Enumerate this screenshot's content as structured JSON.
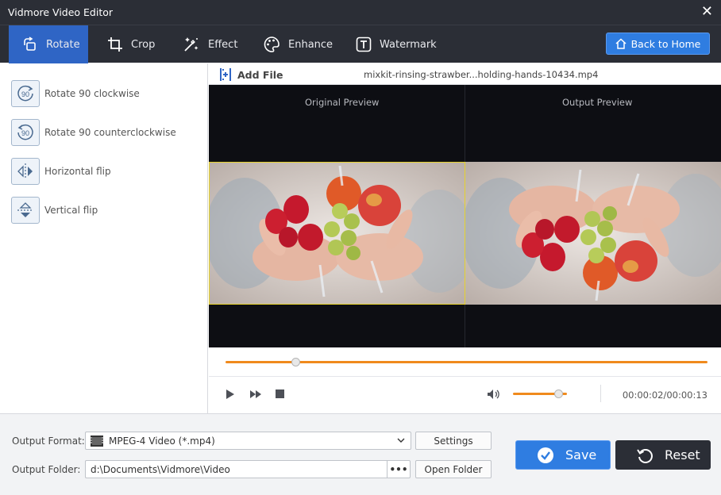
{
  "window": {
    "title": "Vidmore Video Editor"
  },
  "tabs": [
    {
      "label": "Rotate",
      "active": true,
      "icon": "rotate-icon"
    },
    {
      "label": "Crop",
      "active": false,
      "icon": "crop-icon"
    },
    {
      "label": "Effect",
      "active": false,
      "icon": "effect-icon"
    },
    {
      "label": "Enhance",
      "active": false,
      "icon": "enhance-icon"
    },
    {
      "label": "Watermark",
      "active": false,
      "icon": "watermark-icon"
    }
  ],
  "back_home": "Back to Home",
  "rotate_options": [
    {
      "label": "Rotate 90 clockwise",
      "icon": "rotate-90-clockwise-icon",
      "glyph": "90"
    },
    {
      "label": "Rotate 90 counterclockwise",
      "icon": "rotate-90-counterclockwise-icon",
      "glyph": "90"
    },
    {
      "label": "Horizontal flip",
      "icon": "horizontal-flip-icon"
    },
    {
      "label": "Vertical flip",
      "icon": "vertical-flip-icon"
    }
  ],
  "file_bar": {
    "add_file": "Add File",
    "filename": "mixkit-rinsing-strawber...holding-hands-10434.mp4"
  },
  "preview": {
    "original_label": "Original Preview",
    "output_label": "Output Preview"
  },
  "player": {
    "progress": 0.146,
    "volume": 0.85,
    "timecode": "00:00:02/00:00:13"
  },
  "output": {
    "format_label": "Output Format:",
    "format_value": "MPEG-4 Video (*.mp4)",
    "settings": "Settings",
    "folder_label": "Output Folder:",
    "folder_value": "d:\\Documents\\Vidmore\\Video",
    "browse": "•••",
    "open_folder": "Open Folder",
    "save": "Save",
    "reset": "Reset"
  },
  "colors": {
    "accent": "#2f7de1",
    "dark": "#2b2e36",
    "progress": "#f08a1d"
  }
}
